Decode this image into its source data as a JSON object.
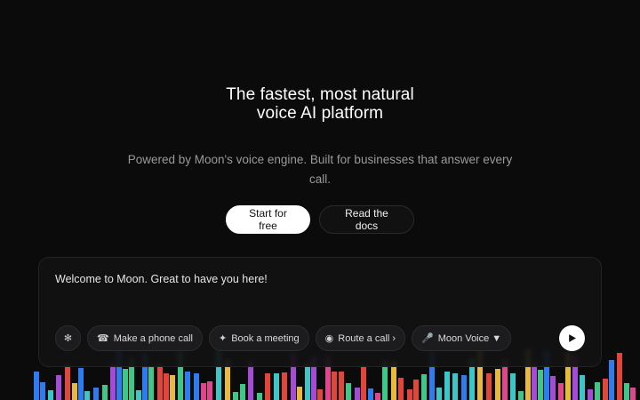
{
  "hero": {
    "title_line1": "The fastest, most natural",
    "title_line2": "voice AI platform",
    "subtitle": "Powered by Moon's voice engine. Built for businesses that answer every call."
  },
  "cta": {
    "primary_label": "Start for free",
    "secondary_label": "Read the docs"
  },
  "composer": {
    "message": "Welcome to Moon. Great to have you here!",
    "settings_icon": "sparkle-icon",
    "chips": [
      {
        "icon": "phone-icon",
        "glyph": "☎",
        "label": "Make a phone call"
      },
      {
        "icon": "sparkle-icon",
        "glyph": "✦",
        "label": "Book a meeting"
      },
      {
        "icon": "radio-icon",
        "glyph": "◉",
        "label": "Route a call ›"
      },
      {
        "icon": "microphone-icon",
        "glyph": "🎤",
        "label": "Moon Voice ▼"
      }
    ],
    "send_icon": "play-icon"
  },
  "colors": {
    "background": "#0b0b0c",
    "bars": [
      "#e0463a",
      "#a64ad8",
      "#3fc78a",
      "#2f7bf0",
      "#e8b93a",
      "#e0468e",
      "#3cc6c8"
    ]
  }
}
